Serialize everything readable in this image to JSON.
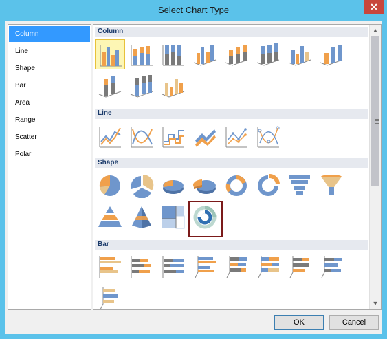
{
  "window": {
    "title": "Select Chart Type",
    "close_glyph": "✕"
  },
  "left_list": {
    "items": [
      "Column",
      "Line",
      "Shape",
      "Bar",
      "Area",
      "Range",
      "Scatter",
      "Polar"
    ],
    "selected": "Column"
  },
  "categories": {
    "column": {
      "label": "Column",
      "tile_count": 11
    },
    "line": {
      "label": "Line",
      "tile_count": 6
    },
    "shape": {
      "label": "Shape",
      "tile_count": 12
    },
    "bar": {
      "label": "Bar",
      "tile_count": 9
    }
  },
  "scrollbar": {
    "up_glyph": "▲",
    "down_glyph": "▼"
  },
  "buttons": {
    "ok": "OK",
    "cancel": "Cancel"
  },
  "colors": {
    "orange": "#f0a04b",
    "blue": "#6f96cc",
    "gray": "#7a7a7a",
    "tan": "#e8c48a",
    "select_blue": "#3399ff",
    "highlight_border": "#7b1a1a"
  }
}
